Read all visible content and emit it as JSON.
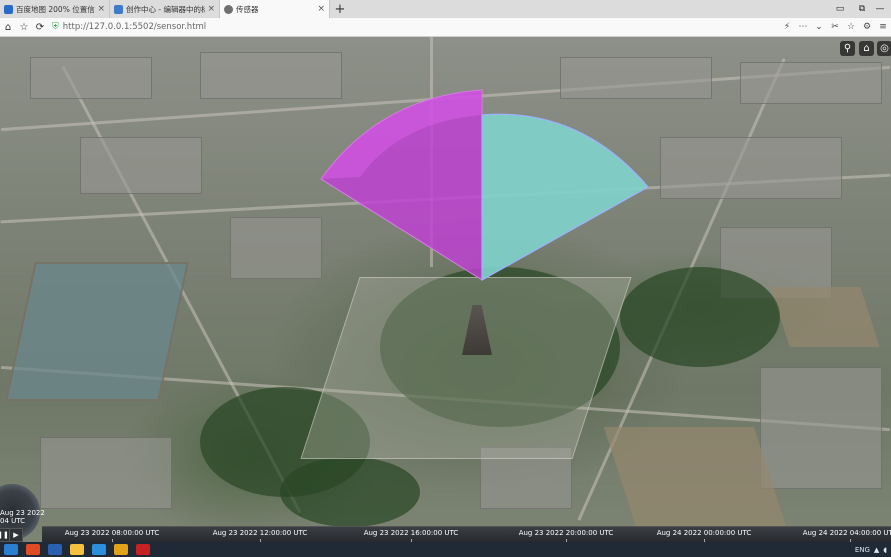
{
  "tabs": [
    {
      "title": "百度地图 200% 位置信息 - 百...",
      "icon_color": "#2a6ac9",
      "active": false
    },
    {
      "title": "创作中心 - 编辑器中的标注...",
      "icon_color": "#3d7cc9",
      "active": false
    },
    {
      "title": "传感器",
      "icon_color": "#707070",
      "active": true
    }
  ],
  "tab_close": "×",
  "new_tab": "+",
  "window_controls": {
    "restore": "🔲",
    "maximize": "🗖",
    "minimize": "—",
    "close": "✕"
  },
  "addressbar": {
    "url": "http://127.0.0.1:5502/sensor.html",
    "back": "←",
    "forward": "→",
    "refresh": "⟳",
    "home": "⌂"
  },
  "toolbar_glyphs": [
    "⚡",
    "⋯",
    "⌄",
    "✂",
    "☆",
    "⚙",
    "≡"
  ],
  "scene_buttons": [
    {
      "name": "search-icon",
      "glyph": "🔍"
    },
    {
      "name": "home-icon",
      "glyph": "⌂"
    },
    {
      "name": "globe-icon",
      "glyph": "🌐"
    }
  ],
  "animation": {
    "date_line1": "Aug 23 2022",
    "date_line2": "04 UTC",
    "play": "▶",
    "pause": "❚❚"
  },
  "timeline": {
    "labels": [
      "Aug 23 2022 08:00:00 UTC",
      "Aug 23 2022 12:00:00 UTC",
      "Aug 23 2022 16:00:00 UTC",
      "Aug 23 2022 20:00:00 UTC",
      "Aug 24 2022 00:00:00 UTC",
      "Aug 24 2022 04:00:00 UTC"
    ]
  },
  "sensor": {
    "colors": {
      "left": "#c13fd6",
      "right": "#7fd3cc",
      "rim": "#9fb0ff"
    }
  },
  "taskbar": {
    "apps": [
      {
        "name": "start",
        "color": "#2a7fd0"
      },
      {
        "name": "browser",
        "color": "#e04b26"
      },
      {
        "name": "word",
        "color": "#2b5fb0"
      },
      {
        "name": "explorer",
        "color": "#f3c13b"
      },
      {
        "name": "vscode",
        "color": "#2d8fdc"
      },
      {
        "name": "chrome",
        "color": "#e3a21a"
      },
      {
        "name": "app",
        "color": "#c82121"
      }
    ],
    "tray_text": "ENG"
  }
}
